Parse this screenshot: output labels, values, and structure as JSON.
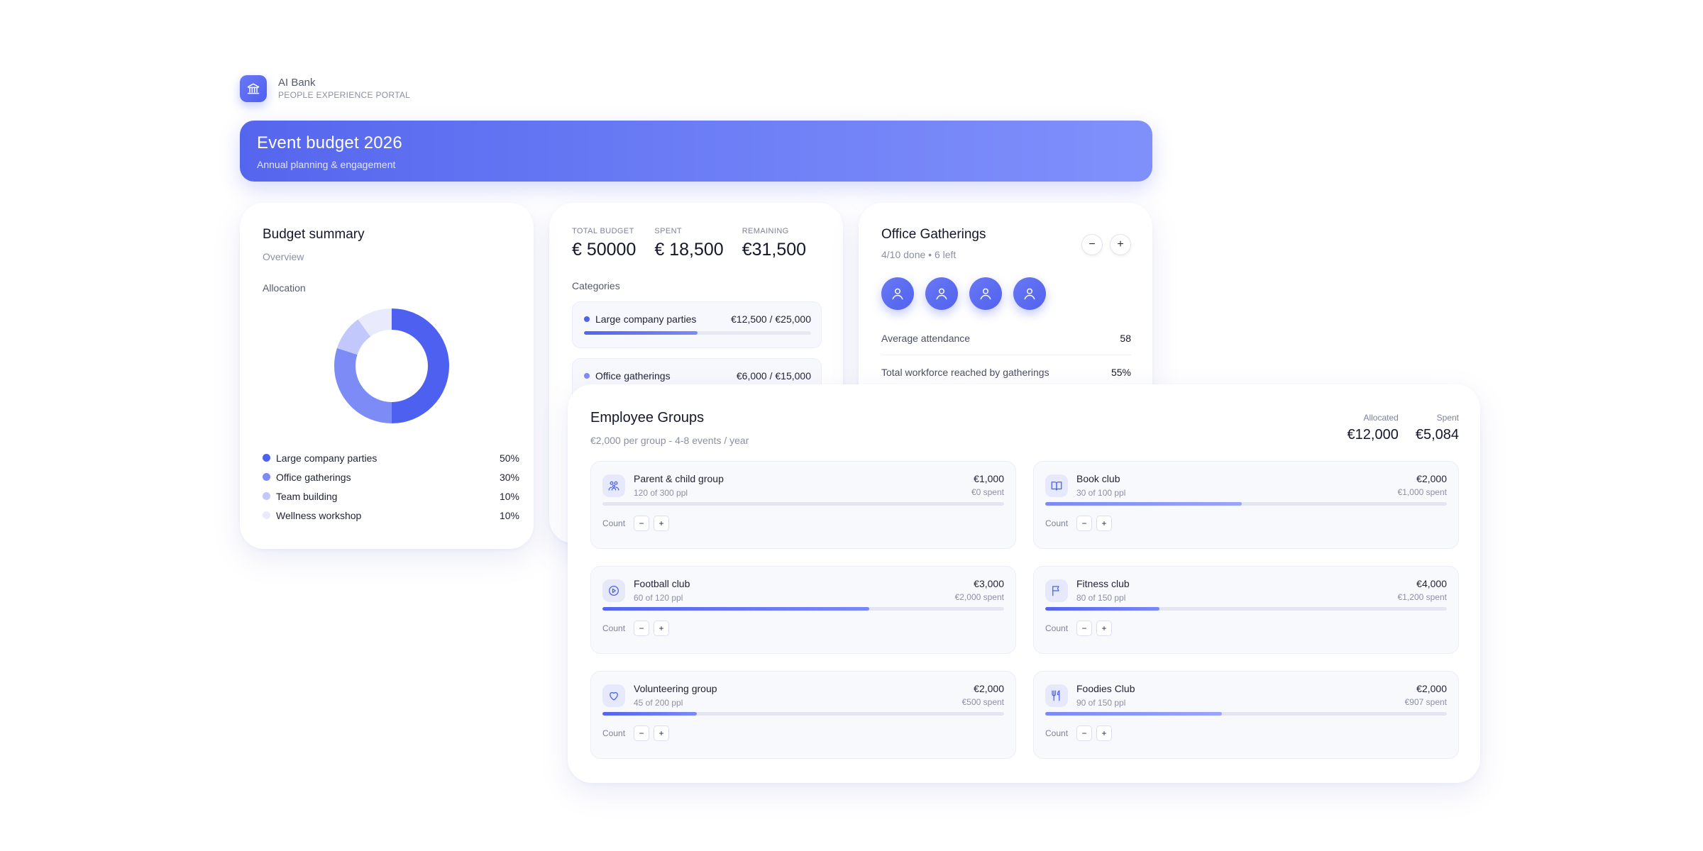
{
  "brand": {
    "name": "AI Bank",
    "subtitle": "PEOPLE EXPERIENCE PORTAL"
  },
  "banner": {
    "title": "Event budget 2026",
    "subtitle": "Annual planning & engagement"
  },
  "summary": {
    "title": "Budget summary",
    "subtitle": "Overview",
    "allocation_label": "Allocation",
    "legend": [
      {
        "label": "Large company parties",
        "value": "50%",
        "pct": 50,
        "color": "#4e60f0"
      },
      {
        "label": "Office gatherings",
        "value": "30%",
        "pct": 30,
        "color": "#7c8bf6"
      },
      {
        "label": "Team building",
        "value": "10%",
        "pct": 10,
        "color": "#c2c8fb"
      },
      {
        "label": "Wellness workshop",
        "value": "10%",
        "pct": 10,
        "color": "#e9ebfd"
      }
    ]
  },
  "totals": {
    "total_label": "TOTAL BUDGET",
    "total_value": "€ 50000",
    "spent_label": "SPENT",
    "spent_value": "€ 18,500",
    "remaining_label": "REMAINING",
    "remaining_value": "€31,500",
    "categories_label": "Categories",
    "categories": [
      {
        "name": "Large company parties",
        "amount": "€12,500 / €25,000",
        "progress": 0.5,
        "color": "#4e60f0"
      },
      {
        "name": "Office gatherings",
        "amount": "€6,000 / €15,000",
        "progress": 0.4,
        "color": "#7c8bf6"
      }
    ]
  },
  "office": {
    "title": "Office Gatherings",
    "subtitle": "4/10 done • 6 left",
    "minus": "−",
    "plus": "+",
    "metrics": [
      {
        "label": "Average attendance",
        "value": "58"
      },
      {
        "label": "Total workforce reached by gatherings",
        "value": "55%"
      }
    ]
  },
  "groups": {
    "title": "Employee Groups",
    "subtitle": "€2,000 per group - 4-8 events / year",
    "allocated_label": "Allocated",
    "allocated_value": "€12,000",
    "spent_label": "Spent",
    "spent_value": "€5,084",
    "count_label": "Count",
    "minus": "−",
    "plus": "+",
    "items": [
      {
        "name": "Parent & child group",
        "ppl": "120 of 300 ppl",
        "amount": "€1,000",
        "spent": "€0 spent",
        "progress": 0.0,
        "icon": "family-icon"
      },
      {
        "name": "Book club",
        "ppl": "30 of 100 ppl",
        "amount": "€2,000",
        "spent": "€1,000 spent",
        "progress": 0.49,
        "icon": "book-icon"
      },
      {
        "name": "Football club",
        "ppl": "60 of 120 ppl",
        "amount": "€3,000",
        "spent": "€2,000 spent",
        "progress": 0.665,
        "icon": "ball-icon"
      },
      {
        "name": "Fitness club",
        "ppl": "80 of 150 ppl",
        "amount": "€4,000",
        "spent": "€1,200 spent",
        "progress": 0.285,
        "icon": "flag-icon"
      },
      {
        "name": "Volunteering group",
        "ppl": "45 of 200 ppl",
        "amount": "€2,000",
        "spent": "€500 spent",
        "progress": 0.235,
        "icon": "heart-icon"
      },
      {
        "name": "Foodies Club",
        "ppl": "90 of 150 ppl",
        "amount": "€2,000",
        "spent": "€907 spent",
        "progress": 0.44,
        "icon": "utensils-icon"
      }
    ]
  }
}
